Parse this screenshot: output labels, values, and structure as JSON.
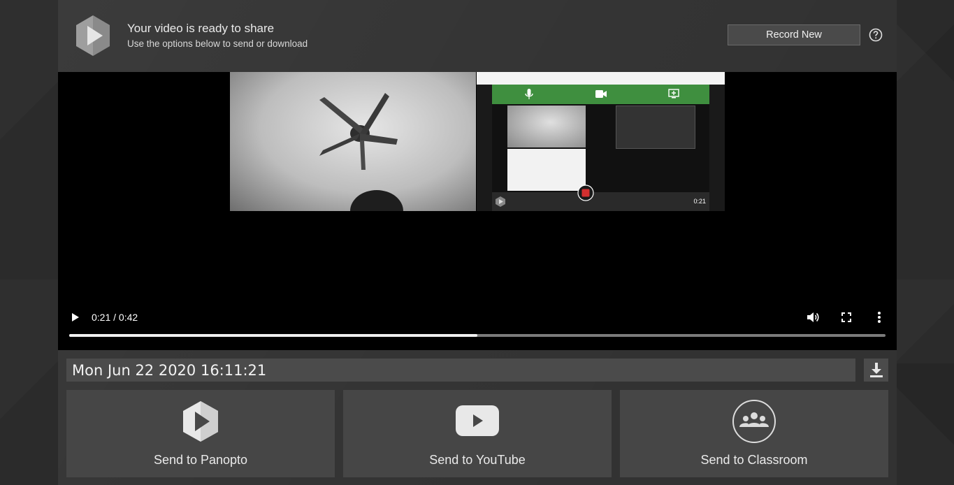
{
  "header": {
    "title": "Your video is ready to share",
    "subtitle": "Use the options below to send or download",
    "record_new_label": "Record New",
    "help_icon": "question-circle-icon"
  },
  "player": {
    "current_time": "0:21",
    "duration": "0:42",
    "time_display": "0:21 / 0:42",
    "progress_fraction": 0.5,
    "embedded_timer": "0:21"
  },
  "recording": {
    "name_value": "Mon Jun 22 2020 16:11:21",
    "download_icon": "download-icon"
  },
  "share": {
    "items": [
      {
        "label": "Send to Panopto",
        "icon": "panopto-logo-icon"
      },
      {
        "label": "Send to YouTube",
        "icon": "youtube-icon"
      },
      {
        "label": "Send to Classroom",
        "icon": "classroom-icon"
      }
    ]
  },
  "colors": {
    "background": "#2b2b2b",
    "panel": "#353535",
    "card": "#464646",
    "video_bg": "#000000",
    "recorder_green": "#3f8f3f",
    "record_red": "#d32f2f"
  }
}
